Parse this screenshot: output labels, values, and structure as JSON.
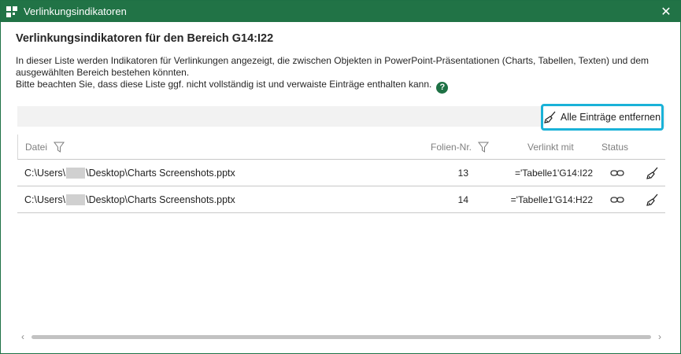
{
  "window": {
    "title": "Verlinkungsindikatoren",
    "close_glyph": "✕",
    "icon": "app-grid-icon"
  },
  "heading": "Verlinkungsindikatoren für den Bereich G14:I22",
  "description": {
    "line1": "In dieser Liste werden Indikatoren für Verlinkungen angezeigt, die zwischen Objekten in PowerPoint-Präsentationen (Charts, Tabellen, Texten) und dem ausgewählten Bereich bestehen könnten.",
    "line2": "Bitte beachten Sie, dass diese Liste ggf. nicht vollständig ist und verwaiste Einträge enthalten kann.",
    "help_glyph": "?"
  },
  "toolbar": {
    "remove_all_label": "Alle Einträge entfernen",
    "remove_all_icon": "broom-icon"
  },
  "table": {
    "columns": {
      "file": "Datei",
      "slide": "Folien-Nr.",
      "linked": "Verlinkt mit",
      "status": "Status"
    },
    "rows": [
      {
        "file_prefix": "C:\\Users\\",
        "file_suffix": "\\Desktop\\Charts Screenshots.pptx",
        "slide": "13",
        "linked": "='Tabelle1'G14:I22",
        "status_icon": "link-icon",
        "action_icon": "broom-icon"
      },
      {
        "file_prefix": "C:\\Users\\",
        "file_suffix": "\\Desktop\\Charts Screenshots.pptx",
        "slide": "14",
        "linked": "='Tabelle1'G14:H22",
        "status_icon": "link-icon",
        "action_icon": "broom-icon"
      }
    ]
  },
  "scrollbar": {
    "left_glyph": "‹",
    "right_glyph": "›"
  },
  "colors": {
    "titlebar": "#217346",
    "highlight": "#1ab2d8",
    "help_icon": "#1e7145"
  }
}
